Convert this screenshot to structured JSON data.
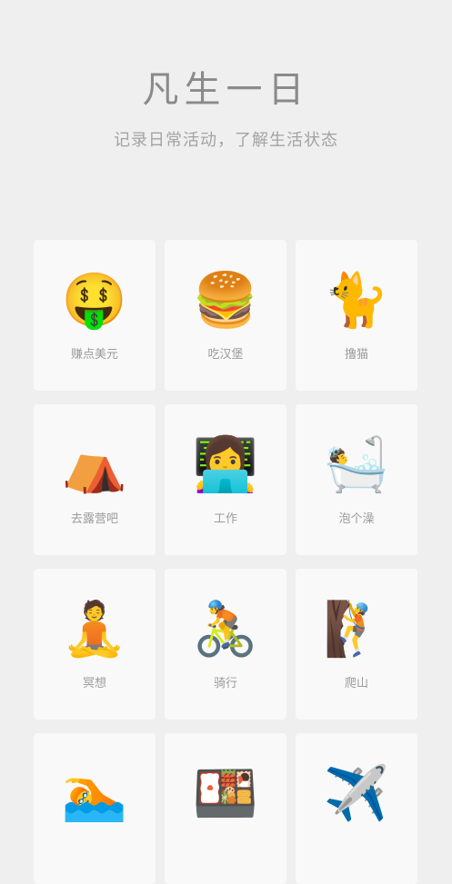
{
  "header": {
    "title": "凡生一日",
    "subtitle": "记录日常活动，了解生活状态"
  },
  "activities": [
    {
      "icon": "money-mouth-face-icon",
      "emoji": "🤑",
      "label": "赚点美元"
    },
    {
      "icon": "hamburger-icon",
      "emoji": "🍔",
      "label": "吃汉堡"
    },
    {
      "icon": "cat-icon",
      "emoji": "🐈",
      "label": "撸猫"
    },
    {
      "icon": "camping-tent-icon",
      "emoji": "⛺",
      "label": "去露营吧"
    },
    {
      "icon": "woman-with-laptop-icon",
      "emoji": "👩‍💻",
      "label": "工作"
    },
    {
      "icon": "bathtub-icon",
      "emoji": "🛀",
      "label": "泡个澡"
    },
    {
      "icon": "meditation-icon",
      "emoji": "🧘",
      "label": "冥想"
    },
    {
      "icon": "cyclist-icon",
      "emoji": "🚴",
      "label": "骑行"
    },
    {
      "icon": "rock-climbing-icon",
      "emoji": "🧗",
      "label": "爬山"
    },
    {
      "icon": "swimming-icon",
      "emoji": "🏊",
      "label": ""
    },
    {
      "icon": "bento-box-icon",
      "emoji": "🍱",
      "label": ""
    },
    {
      "icon": "airplane-icon",
      "emoji": "✈️",
      "label": ""
    }
  ]
}
